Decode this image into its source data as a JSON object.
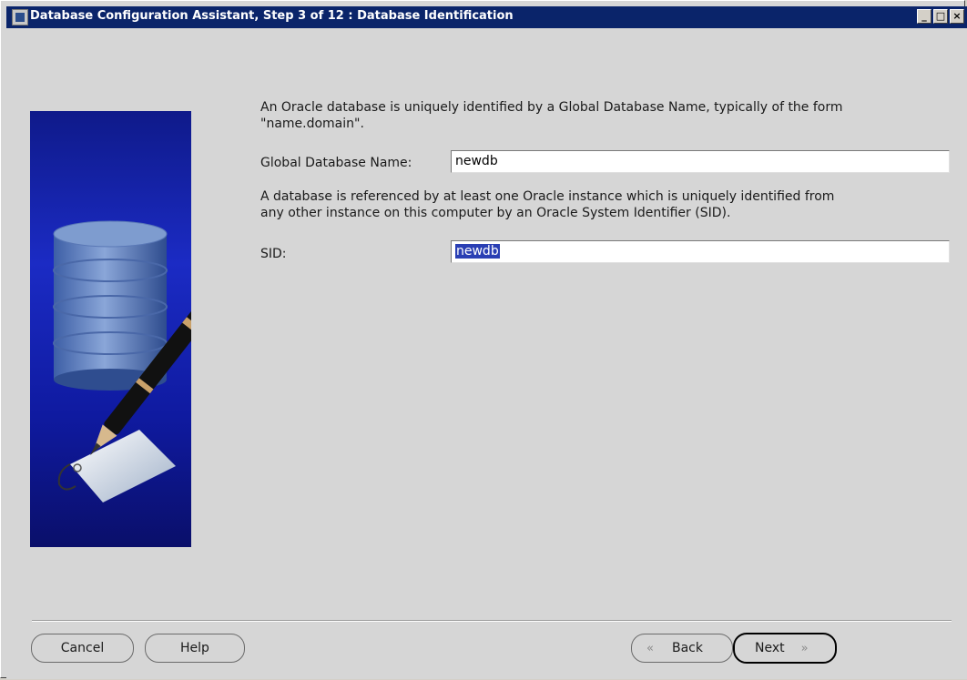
{
  "window": {
    "title": "Database Configuration Assistant, Step 3 of 12 : Database Identification",
    "controls": {
      "minimize": "_",
      "maximize": "□",
      "close": "×"
    }
  },
  "intro_text_line1": "An Oracle database is uniquely identified by a Global Database Name, typically of the form",
  "intro_text_line2": "\"name.domain\".",
  "global_db_name": {
    "label": "Global Database Name:",
    "value": "newdb"
  },
  "sid_description_line1": "A database is referenced by at least one Oracle instance which is uniquely identified from",
  "sid_description_line2": "any other instance on this computer by an Oracle System Identifier (SID).",
  "sid": {
    "label": "SID:",
    "value": "newdb"
  },
  "buttons": {
    "cancel": "Cancel",
    "help": "Help",
    "back": "Back",
    "back_icon": "«",
    "next": "Next",
    "next_icon": "»"
  },
  "colors": {
    "titlebar": "#0a246a",
    "selection": "#2a3fb4",
    "illustration_bg": "#1b2bc4"
  }
}
